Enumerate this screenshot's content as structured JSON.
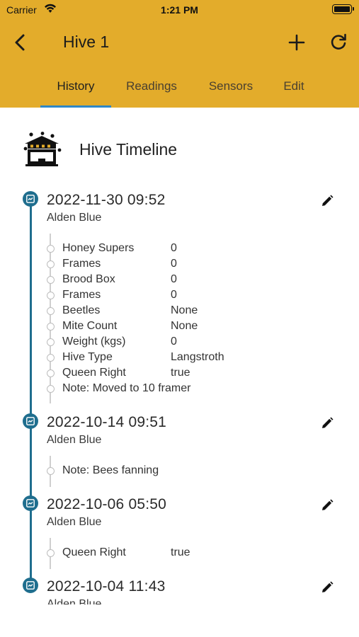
{
  "status_bar": {
    "carrier": "Carrier",
    "time": "1:21 PM"
  },
  "header": {
    "title": "Hive 1",
    "back_icon": "chevron-left-icon",
    "add_icon": "plus-icon",
    "refresh_icon": "refresh-icon"
  },
  "tabs": [
    {
      "label": "History",
      "active": true
    },
    {
      "label": "Readings",
      "active": false
    },
    {
      "label": "Sensors",
      "active": false
    },
    {
      "label": "Edit",
      "active": false
    }
  ],
  "section": {
    "title": "Hive Timeline",
    "icon": "beehive-icon"
  },
  "timeline": [
    {
      "date": "2022-11-30 09:52",
      "user": "Alden Blue",
      "details": [
        {
          "label": "Honey Supers",
          "value": "0"
        },
        {
          "label": "Frames",
          "value": "0"
        },
        {
          "label": "Brood Box",
          "value": "0"
        },
        {
          "label": "Frames",
          "value": "0"
        },
        {
          "label": "Beetles",
          "value": "None"
        },
        {
          "label": "Mite Count",
          "value": "None"
        },
        {
          "label": "Weight (kgs)",
          "value": "0"
        },
        {
          "label": "Hive Type",
          "value": "Langstroth"
        },
        {
          "label": "Queen Right",
          "value": "true"
        },
        {
          "label": "Note: Moved to 10 framer",
          "value": ""
        }
      ]
    },
    {
      "date": "2022-10-14 09:51",
      "user": "Alden Blue",
      "details": [
        {
          "label": "Note: Bees fanning",
          "value": ""
        }
      ]
    },
    {
      "date": "2022-10-06 05:50",
      "user": "Alden Blue",
      "details": [
        {
          "label": "Queen Right",
          "value": "true"
        }
      ]
    },
    {
      "date": "2022-10-04 11:43",
      "user": "Alden Blue",
      "details": []
    }
  ],
  "colors": {
    "app_bar": "#e3ac2b",
    "tab_indicator": "#2e87c6",
    "timeline": "#1f6e8e"
  }
}
